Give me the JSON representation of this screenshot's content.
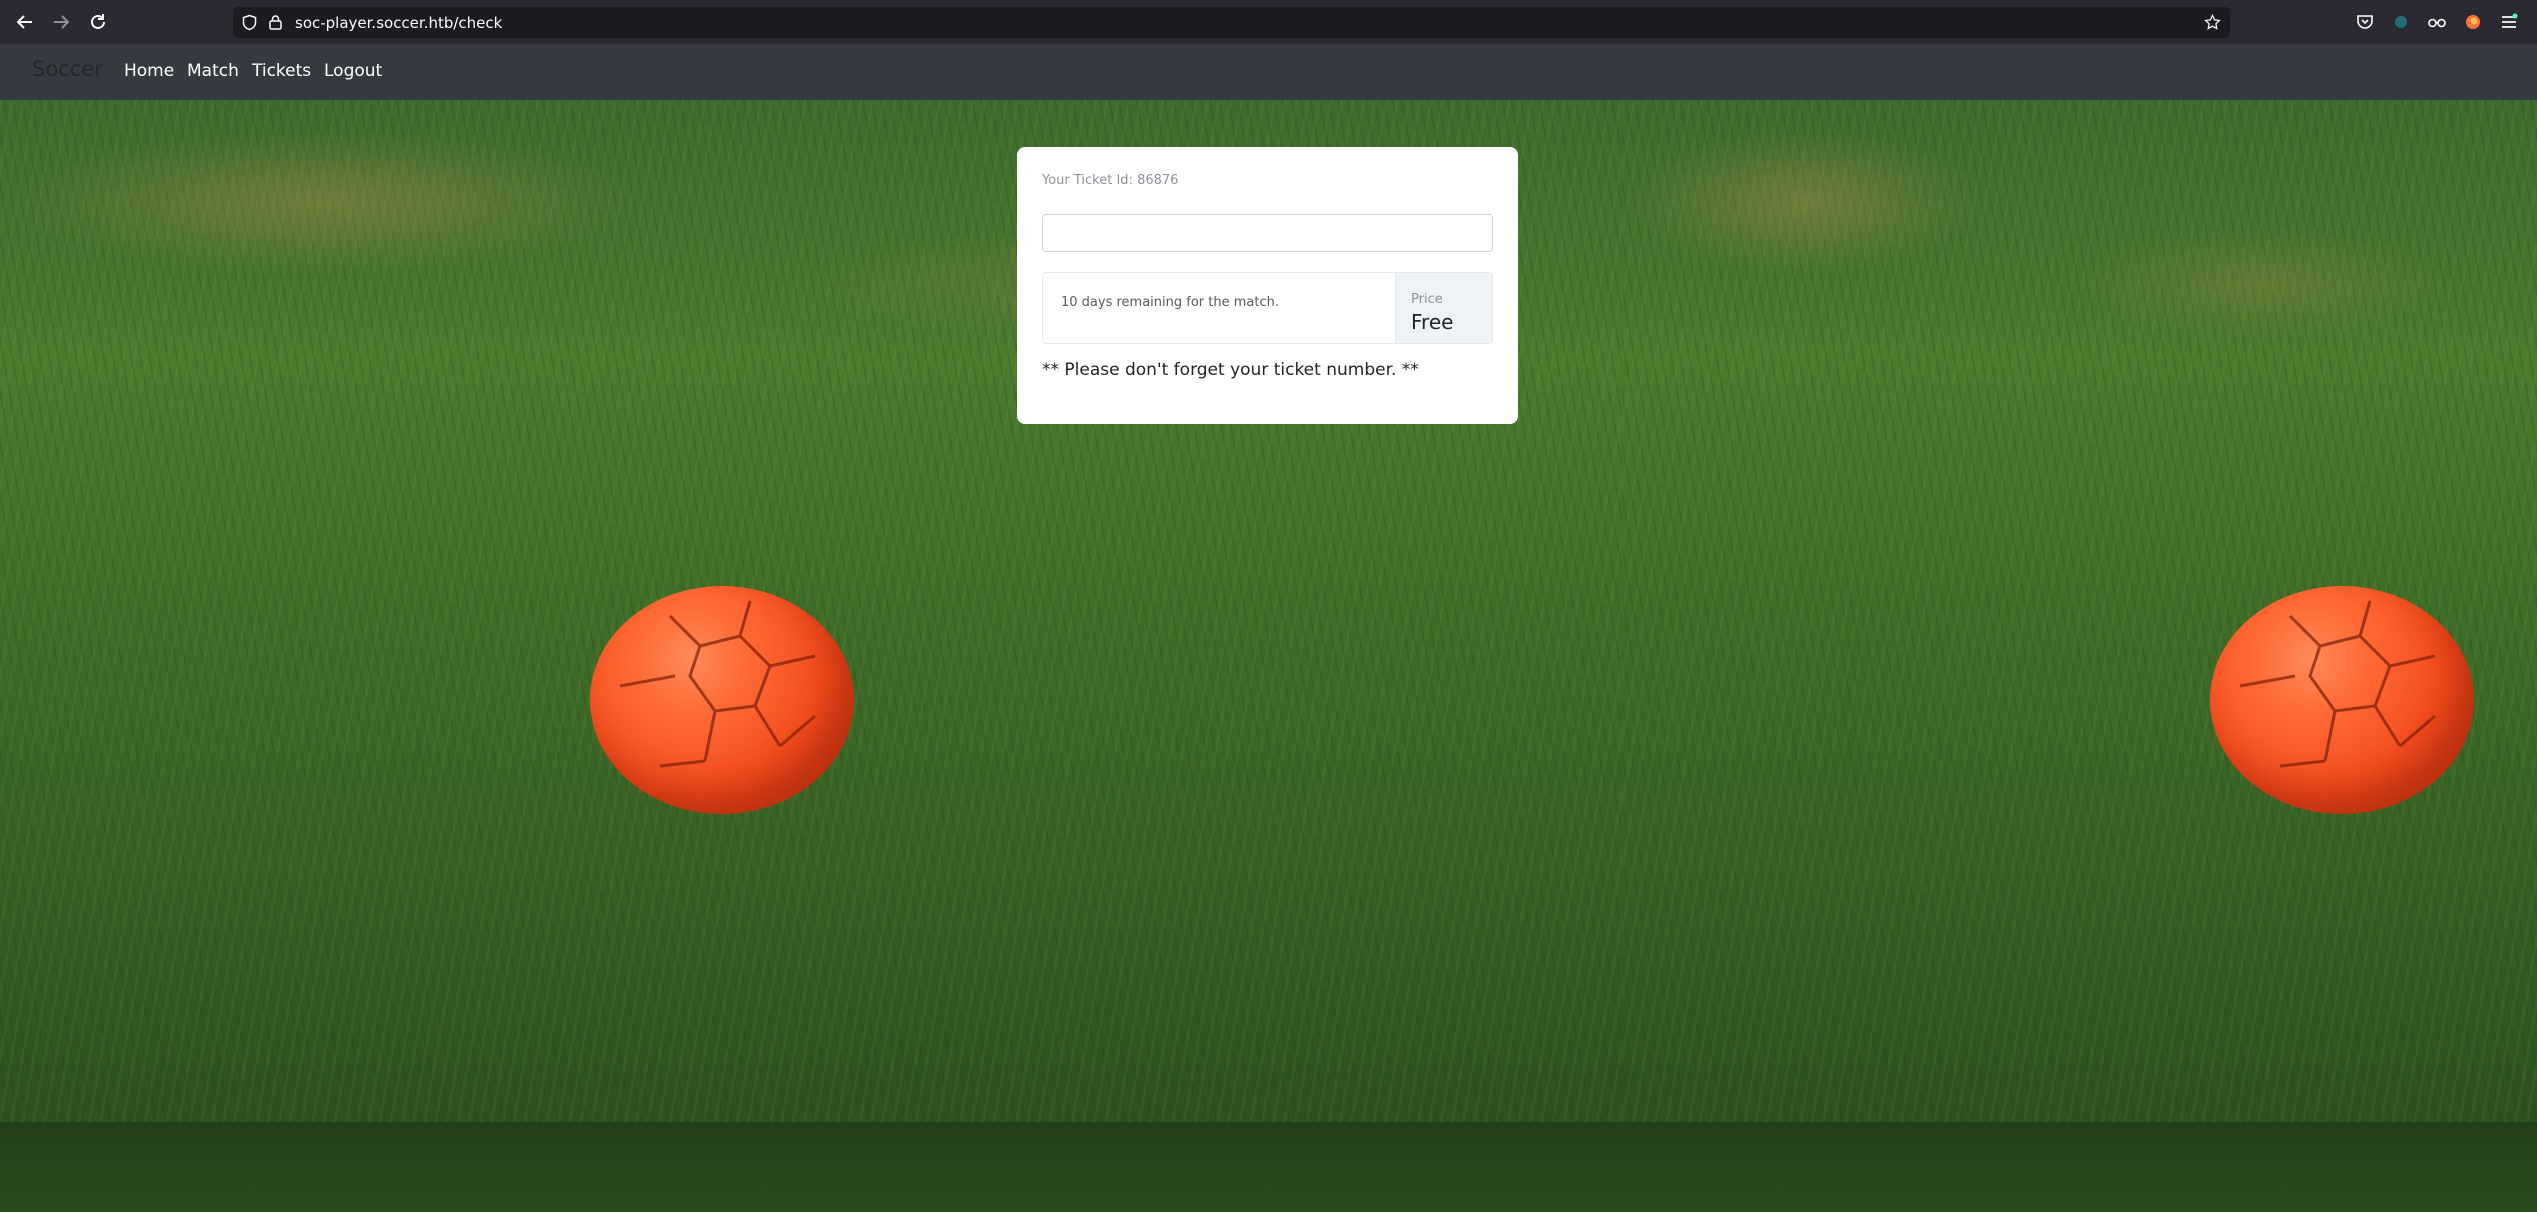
{
  "browser": {
    "url": "soc-player.soccer.htb/check"
  },
  "site_nav": {
    "brand": "Soccer",
    "links": [
      "Home",
      "Match",
      "Tickets",
      "Logout"
    ]
  },
  "ticket_card": {
    "ticket_id_label": "Your Ticket Id: 86876",
    "ticket_input_value": "",
    "days_remaining": "10 days remaining for the match.",
    "price_label": "Price",
    "price_value": "Free",
    "reminder": "** Please don't forget your ticket number. **"
  },
  "colors": {
    "browser_bg": "#2b2a33",
    "urlbar_bg": "#1c1b22",
    "navbar_bg": "#363a40",
    "card_bg": "#ffffff",
    "price_bg": "#eff3f8",
    "ball": "#f24a1c",
    "grass": "#4c7a2f"
  },
  "icons": [
    "back-arrow-icon",
    "forward-arrow-icon",
    "reload-icon",
    "shield-icon",
    "lock-icon",
    "bookmark-star-icon",
    "pocket-icon",
    "extension-icon",
    "glasses-icon",
    "firefox-icon",
    "menu-icon"
  ]
}
